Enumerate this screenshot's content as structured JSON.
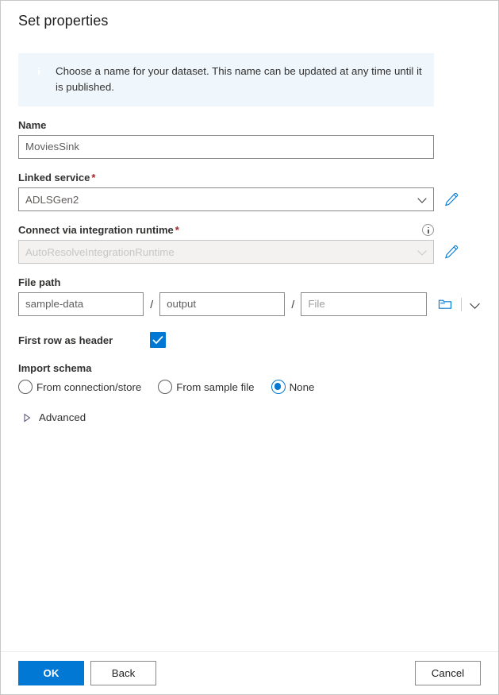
{
  "dialog": {
    "title": "Set properties"
  },
  "info_banner": {
    "icon": "info-filled-icon",
    "message": "Choose a name for your dataset. This name can be updated at any time until it is published."
  },
  "name_field": {
    "label": "Name",
    "value": "MoviesSink"
  },
  "linked_service": {
    "label": "Linked service",
    "required_marker": "*",
    "value": "ADLSGen2",
    "edit_icon": "pencil-icon",
    "dropdown_icon": "chevron-down-icon"
  },
  "integration_runtime": {
    "label": "Connect via integration runtime",
    "required_marker": "*",
    "value": "AutoResolveIntegrationRuntime",
    "disabled": true,
    "info_icon": "info-outline-icon",
    "edit_icon": "pencil-icon",
    "dropdown_icon": "chevron-down-icon"
  },
  "file_path": {
    "label": "File path",
    "container": "sample-data",
    "directory": "output",
    "file_placeholder": "File",
    "separator": "/",
    "browse_icon": "folder-icon",
    "dropdown_icon": "chevron-down-icon"
  },
  "first_row_as_header": {
    "label": "First row as header",
    "checked": true,
    "icon": "checkmark-icon"
  },
  "import_schema": {
    "label": "Import schema",
    "selected": "None",
    "options": [
      {
        "label": "From connection/store",
        "selected": false
      },
      {
        "label": "From sample file",
        "selected": false
      },
      {
        "label": "None",
        "selected": true
      }
    ]
  },
  "advanced": {
    "label": "Advanced",
    "expanded": false,
    "icon": "chevron-right-triangle-icon"
  },
  "footer": {
    "ok_label": "OK",
    "back_label": "Back",
    "cancel_label": "Cancel"
  },
  "colors": {
    "accent": "#0078d4",
    "banner_bg": "#eff6fc",
    "required": "#a4262c",
    "text": "#323130",
    "border": "#8a8886",
    "disabled_text": "#c8c6c4"
  }
}
